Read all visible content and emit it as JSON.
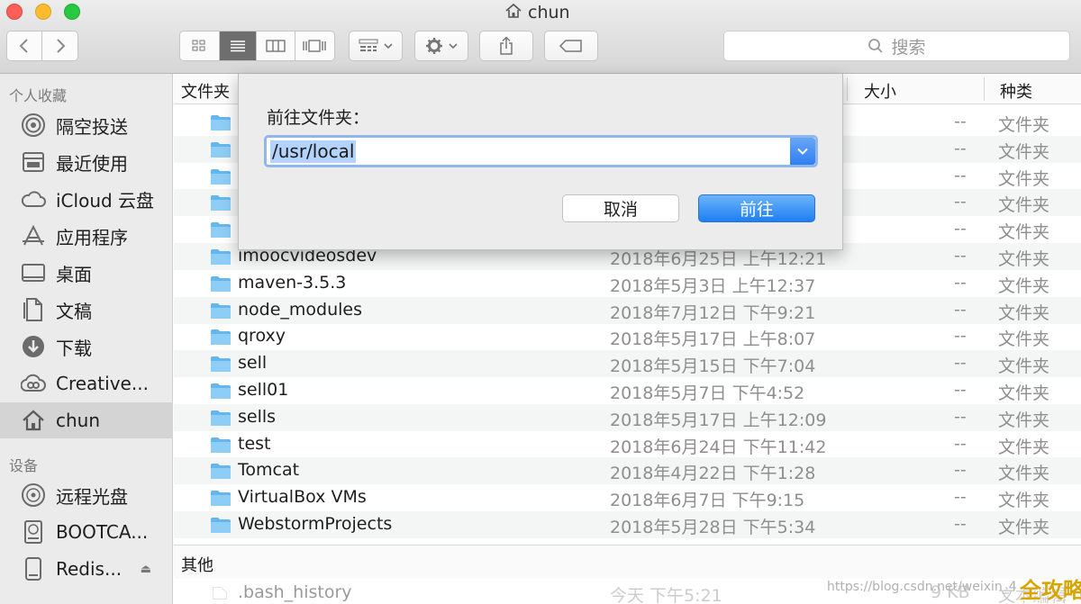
{
  "window": {
    "title": "chun"
  },
  "toolbar": {
    "search_placeholder": "搜索"
  },
  "sidebar": {
    "favorites_header": "个人收藏",
    "favorites": [
      {
        "label": "隔空投送",
        "icon": "airdrop-icon"
      },
      {
        "label": "最近使用",
        "icon": "recents-icon"
      },
      {
        "label": "iCloud 云盘",
        "icon": "cloud-icon"
      },
      {
        "label": "应用程序",
        "icon": "applications-icon"
      },
      {
        "label": "桌面",
        "icon": "desktop-icon"
      },
      {
        "label": "文稿",
        "icon": "documents-icon"
      },
      {
        "label": "下载",
        "icon": "download-icon"
      },
      {
        "label": "Creative...",
        "icon": "creative-cloud-icon"
      },
      {
        "label": "chun",
        "icon": "home-icon",
        "selected": true
      }
    ],
    "devices_header": "设备",
    "devices": [
      {
        "label": "远程光盘",
        "icon": "disc-icon"
      },
      {
        "label": "BOOTCA...",
        "icon": "hard-drive-icon"
      },
      {
        "label": "Redis...",
        "icon": "external-drive-icon"
      }
    ]
  },
  "columns": {
    "name": "文件夹",
    "size": "大小",
    "kind": "种类"
  },
  "files": [
    {
      "name": "",
      "date": "",
      "size": "--",
      "kind": "文件夹"
    },
    {
      "name": "",
      "date": "",
      "size": "--",
      "kind": "文件夹"
    },
    {
      "name": "",
      "date": "",
      "size": "--",
      "kind": "文件夹"
    },
    {
      "name": "",
      "date": "",
      "size": "--",
      "kind": "文件夹"
    },
    {
      "name": "",
      "date": "",
      "size": "--",
      "kind": "文件夹"
    },
    {
      "name": "imoocvideosdev",
      "date": "2018年6月25日 上午12:21",
      "size": "--",
      "kind": "文件夹"
    },
    {
      "name": "maven-3.5.3",
      "date": "2018年5月3日 上午12:37",
      "size": "--",
      "kind": "文件夹"
    },
    {
      "name": "node_modules",
      "date": "2018年7月12日 下午9:21",
      "size": "--",
      "kind": "文件夹"
    },
    {
      "name": "qroxy",
      "date": "2018年5月17日 上午8:07",
      "size": "--",
      "kind": "文件夹"
    },
    {
      "name": "sell",
      "date": "2018年5月15日 下午7:04",
      "size": "--",
      "kind": "文件夹"
    },
    {
      "name": "sell01",
      "date": "2018年5月7日 下午4:52",
      "size": "--",
      "kind": "文件夹"
    },
    {
      "name": "sells",
      "date": "2018年5月17日 上午12:09",
      "size": "--",
      "kind": "文件夹"
    },
    {
      "name": "test",
      "date": "2018年6月24日 下午11:42",
      "size": "--",
      "kind": "文件夹"
    },
    {
      "name": "Tomcat",
      "date": "2018年4月22日 下午1:28",
      "size": "--",
      "kind": "文件夹"
    },
    {
      "name": "VirtualBox VMs",
      "date": "2018年6月7日 下午9:15",
      "size": "--",
      "kind": "文件夹"
    },
    {
      "name": "WebstormProjects",
      "date": "2018年5月28日 下午5:34",
      "size": "--",
      "kind": "文件夹"
    }
  ],
  "other_group": {
    "label": "其他",
    "files": [
      {
        "name": ".bash_history",
        "date": "今天 下午5:21",
        "size": "9 KB",
        "kind": "文本编辑"
      }
    ]
  },
  "dialog": {
    "label": "前往文件夹：",
    "value": "/usr/local",
    "cancel": "取消",
    "go": "前往"
  },
  "watermark": "https://blog.csdn.net/weixin_4",
  "badge": "全攻略"
}
